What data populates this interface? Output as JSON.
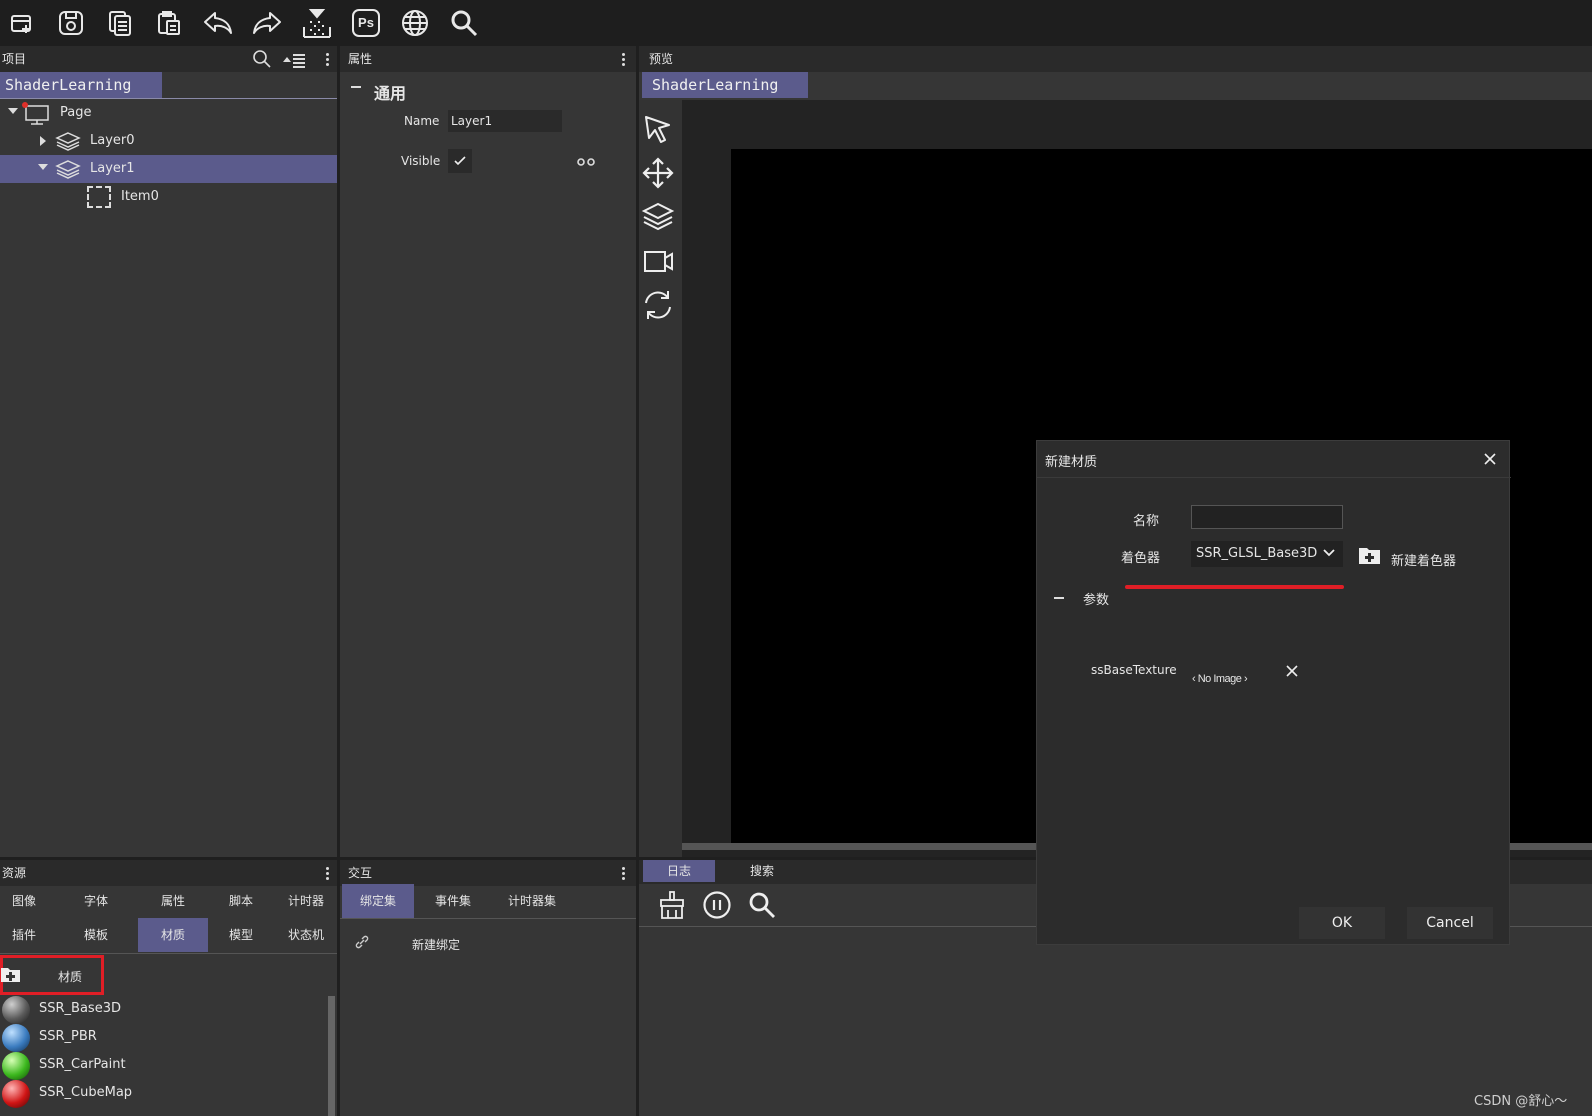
{
  "toolbar": {
    "icons": [
      "new-file-icon",
      "save-icon",
      "copy-icon",
      "paste-icon",
      "undo-icon",
      "redo-icon",
      "build-icon",
      "photoshop-icon",
      "globe-icon",
      "search-icon"
    ],
    "ps_label": "Ps"
  },
  "project": {
    "header": "项目",
    "tab": "ShaderLearning",
    "tree": [
      {
        "label": "Page",
        "level": 0,
        "expanded": true,
        "icon": "monitor-icon"
      },
      {
        "label": "Layer0",
        "level": 1,
        "expanded": false,
        "icon": "layers-icon"
      },
      {
        "label": "Layer1",
        "level": 1,
        "expanded": true,
        "icon": "layers-icon",
        "selected": true
      },
      {
        "label": "Item0",
        "level": 2,
        "icon": "dashed-item-icon"
      }
    ]
  },
  "properties": {
    "header": "属性",
    "section": "通用",
    "name_label": "Name",
    "name_value": "Layer1",
    "visible_label": "Visible",
    "visible_checked": true
  },
  "preview": {
    "header": "预览",
    "tab": "ShaderLearning",
    "tools": [
      "pointer-icon",
      "move-icon",
      "layers-icon",
      "camera-icon",
      "refresh-icon"
    ]
  },
  "resources": {
    "header": "资源",
    "tabs_row1": [
      "图像",
      "字体",
      "属性",
      "脚本",
      "计时器"
    ],
    "tabs_row2": [
      "插件",
      "模板",
      "材质",
      "模型",
      "状态机"
    ],
    "active_tab": "材质",
    "add_label": "材质",
    "materials": [
      {
        "name": "SSR_Base3D",
        "color": "#6a6a6a"
      },
      {
        "name": "SSR_PBR",
        "color": "#3a7bbf"
      },
      {
        "name": "SSR_CarPaint",
        "color": "#3cb81e"
      },
      {
        "name": "SSR_CubeMap",
        "color": "#d01515"
      }
    ]
  },
  "interaction": {
    "header": "交互",
    "tabs": [
      "绑定集",
      "事件集",
      "计时器集"
    ],
    "new_binding": "新建绑定"
  },
  "log": {
    "tabs": [
      "日志",
      "搜索"
    ]
  },
  "dialog": {
    "title": "新建材质",
    "name_label": "名称",
    "name_value": "",
    "shader_label": "着色器",
    "shader_value": "SSR_GLSL_Base3D",
    "new_shader": "新建着色器",
    "params_label": "参数",
    "param_name": "ssBaseTexture",
    "no_image": "‹ No Image ›",
    "ok": "OK",
    "cancel": "Cancel"
  },
  "watermark": "CSDN @舒心～",
  "colors": {
    "accent": "#5b5b8c",
    "highlight_red": "#e01e26"
  }
}
